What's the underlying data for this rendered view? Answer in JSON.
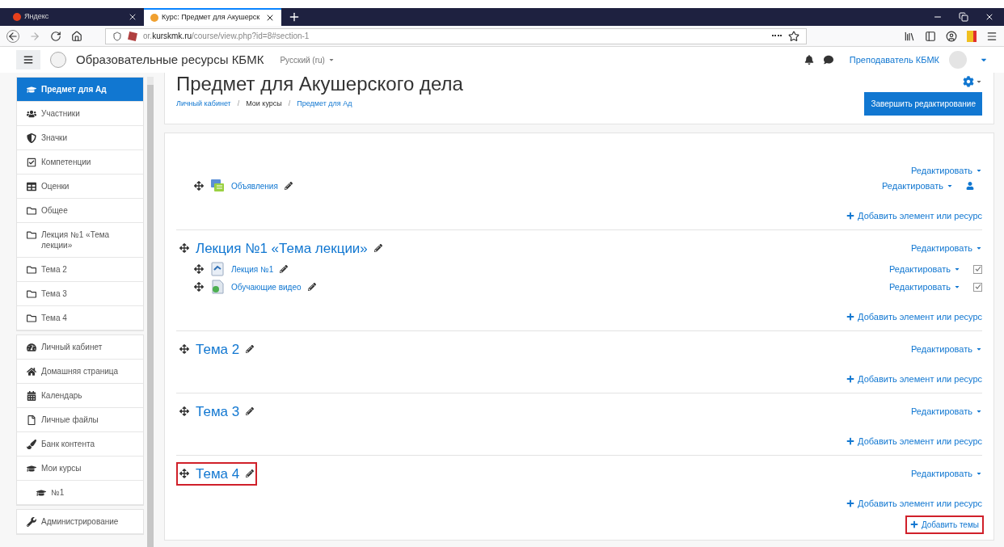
{
  "browser": {
    "tabs": [
      {
        "title": "Яндекс",
        "selected": false
      },
      {
        "title": "Курс: Предмет для Акушерск",
        "selected": true
      }
    ],
    "url_prefix": "or.",
    "url_domain": "kurskmk.ru",
    "url_path": "/course/view.php?id=8#section-1"
  },
  "navbar": {
    "site_name": "Образовательные ресурсы КБМК",
    "language": "Русский (ru)",
    "user": "Преподаватель КБМК"
  },
  "sidebar": {
    "groups": [
      [
        {
          "label": "Предмет для Ад",
          "selected": true
        },
        {
          "label": "Участники",
          "selected": false
        },
        {
          "label": "Значки",
          "selected": false
        },
        {
          "label": "Компетенции",
          "selected": false
        },
        {
          "label": "Оценки",
          "selected": false
        },
        {
          "label": "Общее",
          "selected": false
        },
        {
          "label": "Лекция №1 «Тема лекции»",
          "selected": false
        },
        {
          "label": "Тема 2",
          "selected": false
        },
        {
          "label": "Тема 3",
          "selected": false
        },
        {
          "label": "Тема 4",
          "selected": false
        }
      ],
      [
        {
          "label": "Личный кабинет",
          "selected": false
        },
        {
          "label": "Домашняя страница",
          "selected": false
        },
        {
          "label": "Календарь",
          "selected": false
        },
        {
          "label": "Личные файлы",
          "selected": false
        },
        {
          "label": "Банк контента",
          "selected": false
        },
        {
          "label": "Мои курсы",
          "selected": false
        },
        {
          "label": "№1",
          "selected": false
        }
      ],
      [
        {
          "label": "Администрирование",
          "selected": false
        }
      ]
    ]
  },
  "header": {
    "title": "Предмет для Акушерского дела",
    "breadcrumb": [
      {
        "label": "Личный кабинет",
        "link": true
      },
      {
        "label": "/",
        "link": false
      },
      {
        "label": "Мои курсы",
        "link": false
      },
      {
        "label": "/",
        "link": false
      },
      {
        "label": "Предмет для Ад",
        "link": true
      }
    ],
    "edit_button": "Завершить редактирование"
  },
  "sections": [
    {
      "edit": "Редактировать",
      "activities": [
        {
          "kind": "forum",
          "name": "Объявления",
          "edit": "Редактировать"
        }
      ],
      "add": "Добавить элемент или ресурс"
    },
    {
      "title": "Лекция №1 «Тема лекции»",
      "highlighted": false,
      "edit": "Редактировать",
      "activities": [
        {
          "kind": "file",
          "name": "Лекция №1",
          "edit": "Редактировать",
          "completion": true
        },
        {
          "kind": "video",
          "name": "Обучающие видео",
          "edit": "Редактировать",
          "completion": true
        }
      ],
      "add": "Добавить элемент или ресурс"
    },
    {
      "title": "Тема 2",
      "highlighted": false,
      "edit": "Редактировать",
      "add": "Добавить элемент или ресурс"
    },
    {
      "title": "Тема 3",
      "highlighted": false,
      "edit": "Редактировать",
      "add": "Добавить элемент или ресурс"
    },
    {
      "title": "Тема 4",
      "highlighted": true,
      "edit": "Редактировать",
      "add": "Добавить элемент или ресурс"
    }
  ],
  "add_topics": {
    "label": "Добавить темы",
    "highlighted": true
  }
}
